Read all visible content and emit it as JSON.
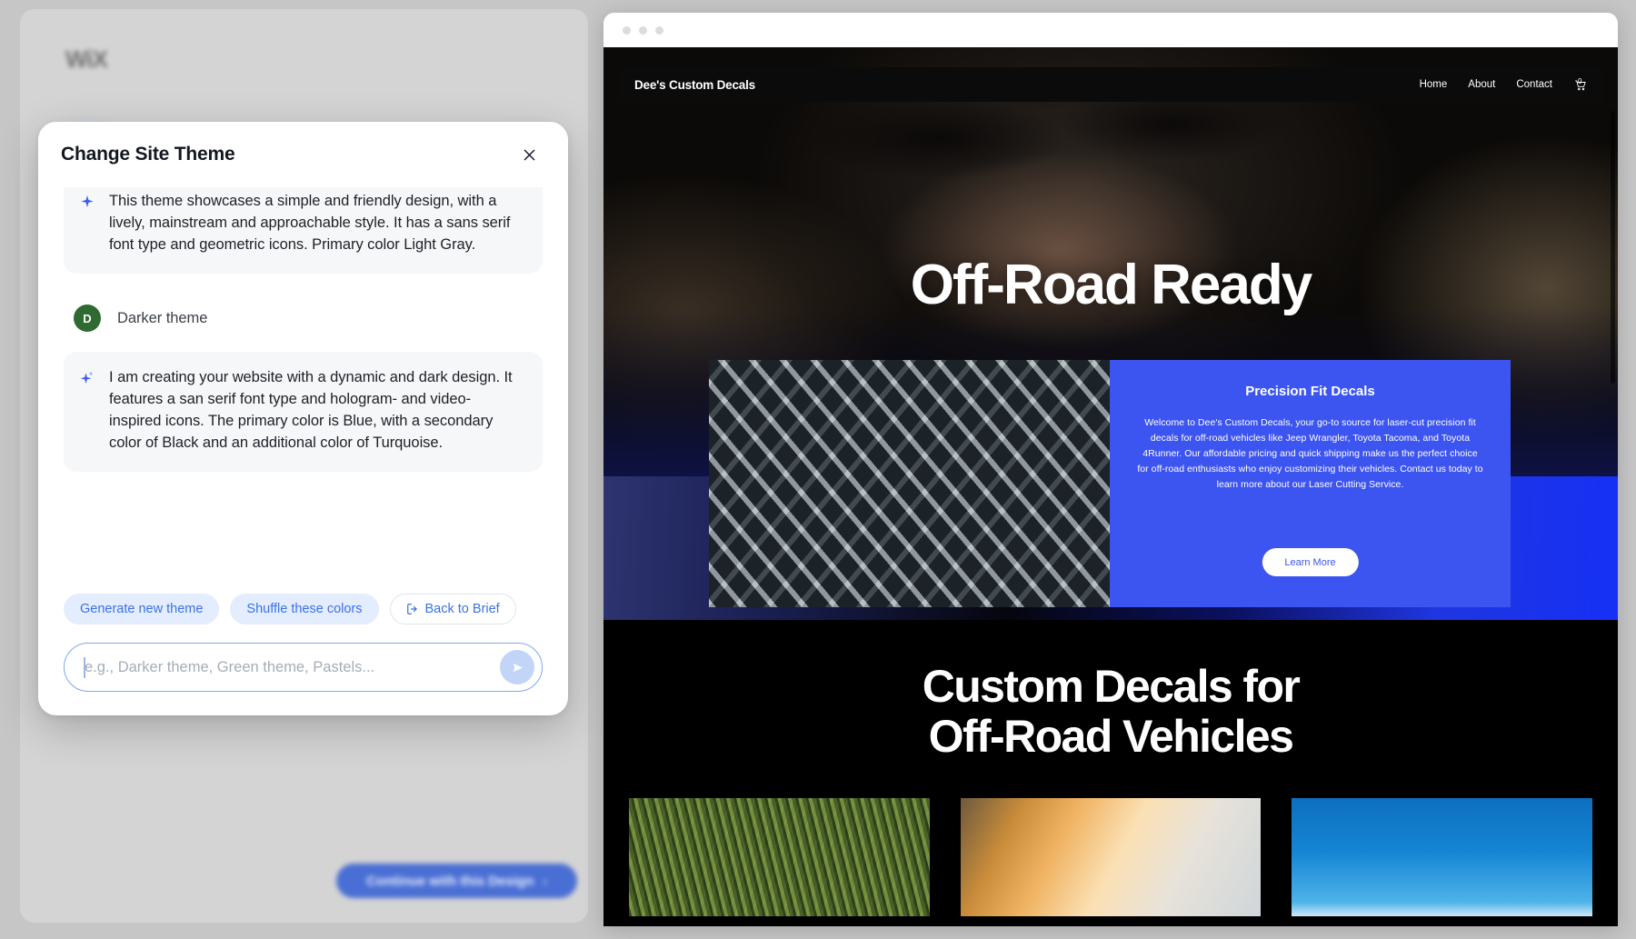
{
  "editor": {
    "logo": "WiX",
    "continue_button": {
      "label": "Continue with this Design",
      "chevron": "›"
    }
  },
  "modal": {
    "title": "Change Site Theme",
    "close_icon": "close-icon",
    "messages": [
      {
        "role": "assistant",
        "icon": "sparkle-icon",
        "text": "This theme showcases a simple and friendly design, with a lively, mainstream and approachable style. It has a sans serif font type and geometric icons. Primary color Light Gray."
      },
      {
        "role": "user",
        "avatar_initial": "D",
        "text": "Darker theme"
      },
      {
        "role": "assistant",
        "icon": "sparkle-icon",
        "text": "I am creating your website with a dynamic and dark design. It features a san serif font type and hologram- and video-inspired icons. The primary color is Blue, with a secondary color of Black and an additional color of Turquoise."
      }
    ],
    "chips": [
      {
        "label": "Generate new theme",
        "style": "filled",
        "icon": null
      },
      {
        "label": "Shuffle these colors",
        "style": "filled",
        "icon": null
      },
      {
        "label": "Back to Brief",
        "style": "outline",
        "icon": "exit-icon"
      }
    ],
    "composer": {
      "placeholder": "e.g., Darker theme, Green theme, Pastels...",
      "value": "",
      "send_icon": "send-icon"
    }
  },
  "preview": {
    "browser_dots": 3,
    "site": {
      "nav": {
        "brand": "Dee's Custom Decals",
        "links": [
          "Home",
          "About",
          "Contact"
        ],
        "cart_icon": "cart-icon",
        "cart_count": "0"
      },
      "hero_title": "Off-Road Ready",
      "feature": {
        "image_alt": "decal-lattice-image",
        "card_title": "Precision Fit Decals",
        "card_body": "Welcome to Dee's Custom Decals, your go-to source for laser-cut precision fit decals for off-road vehicles like Jeep Wrangler, Toyota Tacoma, and Toyota 4Runner. Our affordable pricing and quick shipping make us the perfect choice for off-road enthusiasts who enjoy customizing their vehicles. Contact us today to learn more about our Laser Cutting Service.",
        "cta": "Learn More"
      },
      "section_title_line1": "Custom Decals for",
      "section_title_line2": "Off-Road Vehicles",
      "thumbnails": [
        "foliage-thumbnail",
        "workshop-thumbnail",
        "sky-thumbnail"
      ]
    }
  },
  "colors": {
    "accent_blue": "#3b72e8",
    "chip_fill": "#e4edfd",
    "site_blue": "#3d55f0",
    "avatar_green": "#2f6b31",
    "modal_bg": "#ffffff",
    "message_bg": "#f6f7f8"
  }
}
